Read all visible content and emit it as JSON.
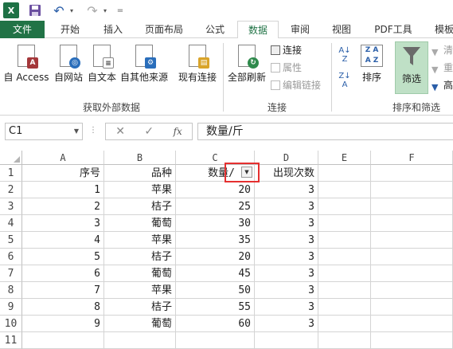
{
  "titlebar": {
    "logo": "X",
    "dd": "▾",
    "custom": "="
  },
  "tabs": [
    "文件",
    "开始",
    "插入",
    "页面布局",
    "公式",
    "数据",
    "审阅",
    "视图",
    "PDF工具",
    "模板"
  ],
  "ribbon": {
    "get_external": {
      "access": "自 Access",
      "web": "自网站",
      "text": "自文本",
      "other": "自其他来源",
      "existing": "现有连接",
      "label": "获取外部数据"
    },
    "connections": {
      "refresh": "全部刷新",
      "conn": "连接",
      "props": "属性",
      "edit_links": "编辑链接",
      "label": "连接"
    },
    "sort_filter": {
      "sort": "排序",
      "filter": "筛选",
      "clear": "清",
      "reapply": "重",
      "advanced": "高",
      "label": "排序和筛选"
    }
  },
  "formula_bar": {
    "name_box": "C1",
    "formula": "数量/斤",
    "fx": "fx"
  },
  "columns": [
    "A",
    "B",
    "C",
    "D",
    "E",
    "F"
  ],
  "rows": [
    "1",
    "2",
    "3",
    "4",
    "5",
    "6",
    "7",
    "8",
    "9",
    "10",
    "11"
  ],
  "table": {
    "headers": [
      "序号",
      "品种",
      "数量/",
      "出现次数"
    ],
    "data": [
      [
        "1",
        "苹果",
        "20",
        "3"
      ],
      [
        "2",
        "桔子",
        "25",
        "3"
      ],
      [
        "3",
        "葡萄",
        "30",
        "3"
      ],
      [
        "4",
        "苹果",
        "35",
        "3"
      ],
      [
        "5",
        "桔子",
        "20",
        "3"
      ],
      [
        "6",
        "葡萄",
        "45",
        "3"
      ],
      [
        "7",
        "苹果",
        "50",
        "3"
      ],
      [
        "8",
        "桔子",
        "55",
        "3"
      ],
      [
        "9",
        "葡萄",
        "60",
        "3"
      ]
    ]
  }
}
